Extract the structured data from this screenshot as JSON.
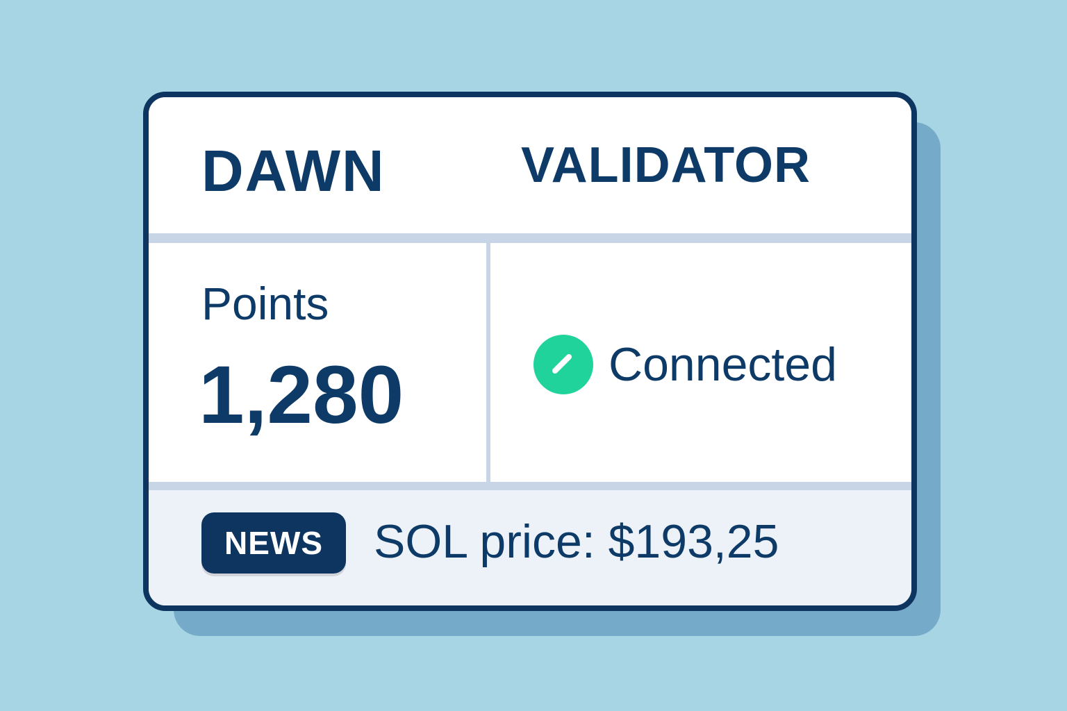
{
  "colors": {
    "background": "#a7d5e4",
    "shadow": "#75aac8",
    "card_border": "#0e3560",
    "text_primary": "#0d3a66",
    "divider": "#c7d5e7",
    "footer_bg": "#edf2f8",
    "status_connected": "#1fd39a",
    "badge_bg": "#0e3560",
    "badge_text": "#ffffff"
  },
  "header": {
    "title_left": "DAWN",
    "title_right": "VALIDATOR"
  },
  "stats": {
    "points_label": "Points",
    "points_value": "1,280"
  },
  "status": {
    "label": "Connected",
    "icon": "check-circle-icon"
  },
  "news": {
    "badge_label": "NEWS",
    "text": "SOL price: $193,25"
  }
}
